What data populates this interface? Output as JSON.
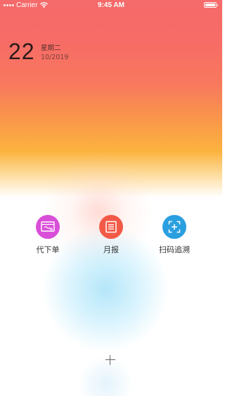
{
  "status_bar": {
    "carrier": "Carrier",
    "time": "9:45 AM",
    "icons": [
      "signal-dots-icon",
      "wifi-icon",
      "battery-icon"
    ]
  },
  "date": {
    "day": "22",
    "weekday": "星期二",
    "month_year": "10/2019"
  },
  "actions": [
    {
      "label": "代下单",
      "icon": "order-card-icon",
      "color": "#d94fd8"
    },
    {
      "label": "月报",
      "icon": "report-list-icon",
      "color": "#f25a47"
    },
    {
      "label": "扫码追溯",
      "icon": "scan-add-icon",
      "color": "#2a9fe0"
    }
  ],
  "add_button": {
    "icon": "plus-icon"
  }
}
